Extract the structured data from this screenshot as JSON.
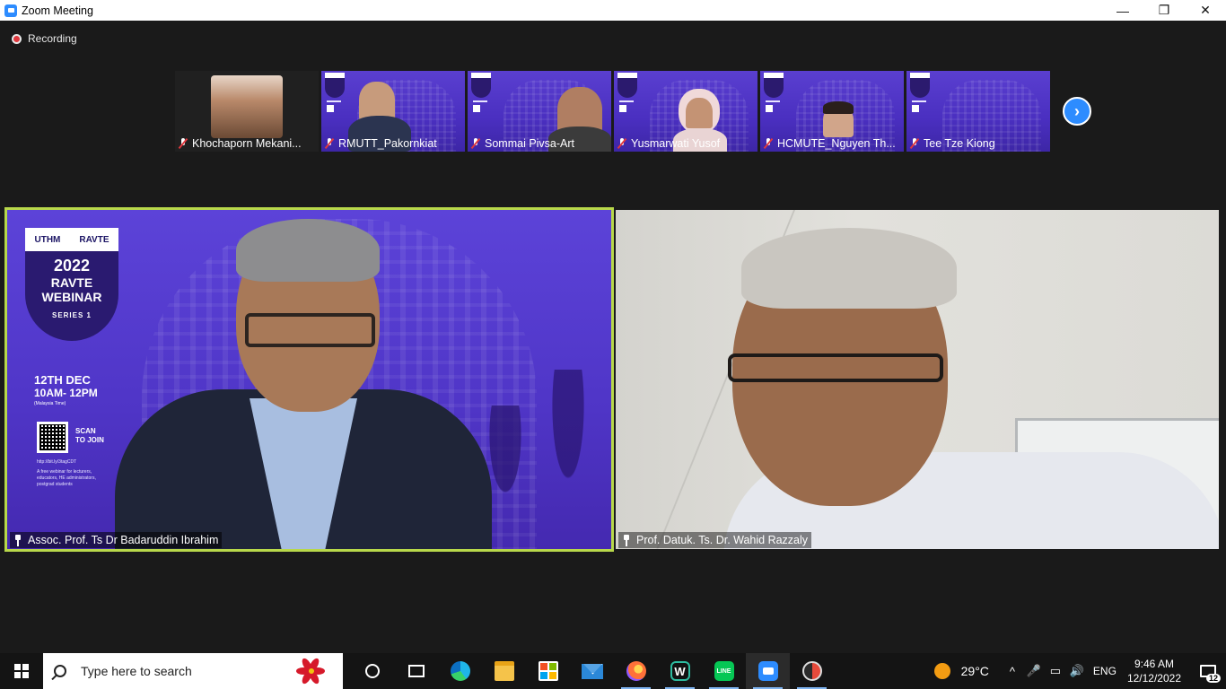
{
  "window": {
    "title": "Zoom Meeting",
    "minimize_label": "—",
    "restore_label": "❐",
    "close_label": "✕"
  },
  "recording": {
    "label": "Recording",
    "color": "#e0383e"
  },
  "participants_strip": [
    {
      "name": "Khochaporn Mekani...",
      "muted": true
    },
    {
      "name": "RMUTT_Pakornkiat",
      "muted": true
    },
    {
      "name": "Sommai Pivsa-Art",
      "muted": true
    },
    {
      "name": "Yusmarwati Yusof",
      "muted": true
    },
    {
      "name": "HCMUTE_Nguyen Th...",
      "muted": true
    },
    {
      "name": "Tee Tze Kiong",
      "muted": true
    }
  ],
  "strip_next_label": "›",
  "main_videos": {
    "left": {
      "name": "Assoc. Prof. Ts Dr Badaruddin Ibrahim",
      "active_speaker": true,
      "highlight_color": "#b8d84a",
      "poster": {
        "logo_a": "UTHM",
        "logo_b": "RAVTE",
        "year": "2022",
        "title_line1": "RAVTE",
        "title_line2": "WEBINAR",
        "series": "SERIES 1",
        "date": "12TH DEC",
        "time": "10AM- 12PM",
        "timezone": "(Malaysia Time)",
        "scan_line1": "SCAN",
        "scan_line2": "TO JOIN",
        "link": "http://bit.ly/3tagCDT",
        "desc": "A free webinar for lecturers, educators, HE administrators, postgrad students"
      }
    },
    "right": {
      "name": "Prof. Datuk. Ts. Dr. Wahid Razzaly",
      "active_speaker": false
    }
  },
  "taskbar": {
    "search_placeholder": "Type here to search",
    "pinned": [
      "cortana-icon",
      "task-view-icon",
      "edge-icon",
      "file-explorer-icon",
      "microsoft-store-icon",
      "mail-icon",
      "firefox-icon",
      "webex-icon",
      "line-icon",
      "zoom-icon",
      "snipping-tool-icon"
    ],
    "webex_glyph": "W",
    "line_text": "LINE",
    "weather_temp": "29°C",
    "chevron": "^",
    "mic_glyph": "🎤",
    "battery_glyph": "▭",
    "volume_glyph": "🔊",
    "language": "ENG",
    "time": "9:46 AM",
    "date": "12/12/2022",
    "notification_count": "12"
  }
}
